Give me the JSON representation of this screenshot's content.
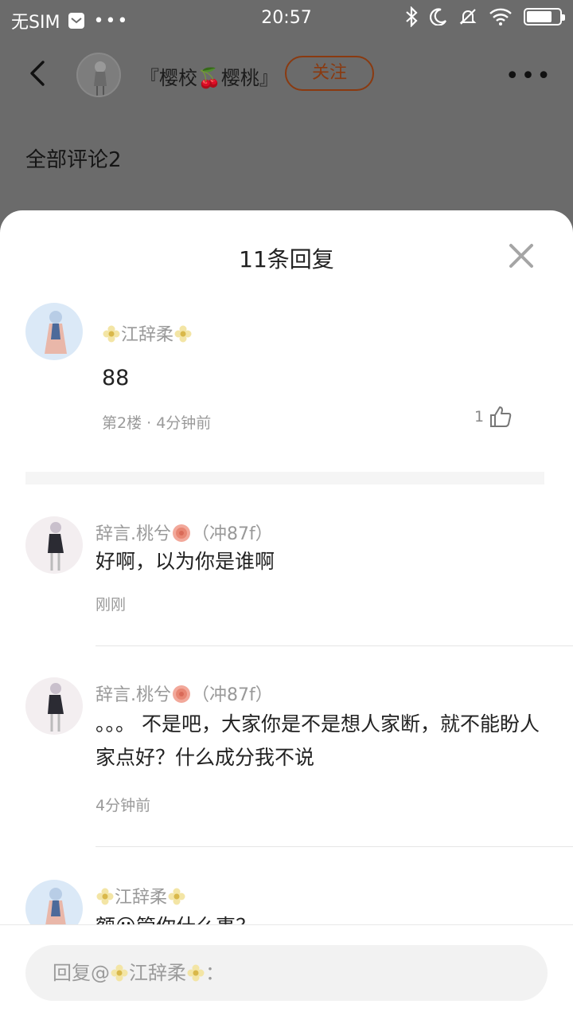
{
  "status": {
    "carrier": "无SIM",
    "time": "20:57",
    "battery_level": 0.78
  },
  "header": {
    "author_name": "『樱校🍒樱桃』",
    "follow_label": "关注",
    "all_comments_label": "全部评论2"
  },
  "sheet": {
    "title": "11条回复",
    "main_comment": {
      "username": "江辞柔",
      "text": "88",
      "meta": "第2楼 · 4分钟前",
      "likes": "1"
    },
    "replies": [
      {
        "username": "辞言.桃兮",
        "tag": "（冲87f）",
        "text": "好啊，以为你是谁啊",
        "time": "刚刚"
      },
      {
        "username": "辞言.桃兮",
        "tag": "（冲87f）",
        "text": "。。。 不是吧，大家你是不是想人家断，就不能盼人家点好？什么成分我不说",
        "time": "4分钟前"
      },
      {
        "username": "江辞柔",
        "text": "额😮管你什么事？"
      }
    ],
    "reply_placeholder_prefix": "回复@",
    "reply_placeholder_name": "江辞柔",
    "reply_placeholder_suffix": "："
  },
  "colors": {
    "accent": "#c8621e",
    "overlay": "#6b6b6b",
    "sheet_bg": "#ffffff",
    "muted_text": "#999999"
  }
}
